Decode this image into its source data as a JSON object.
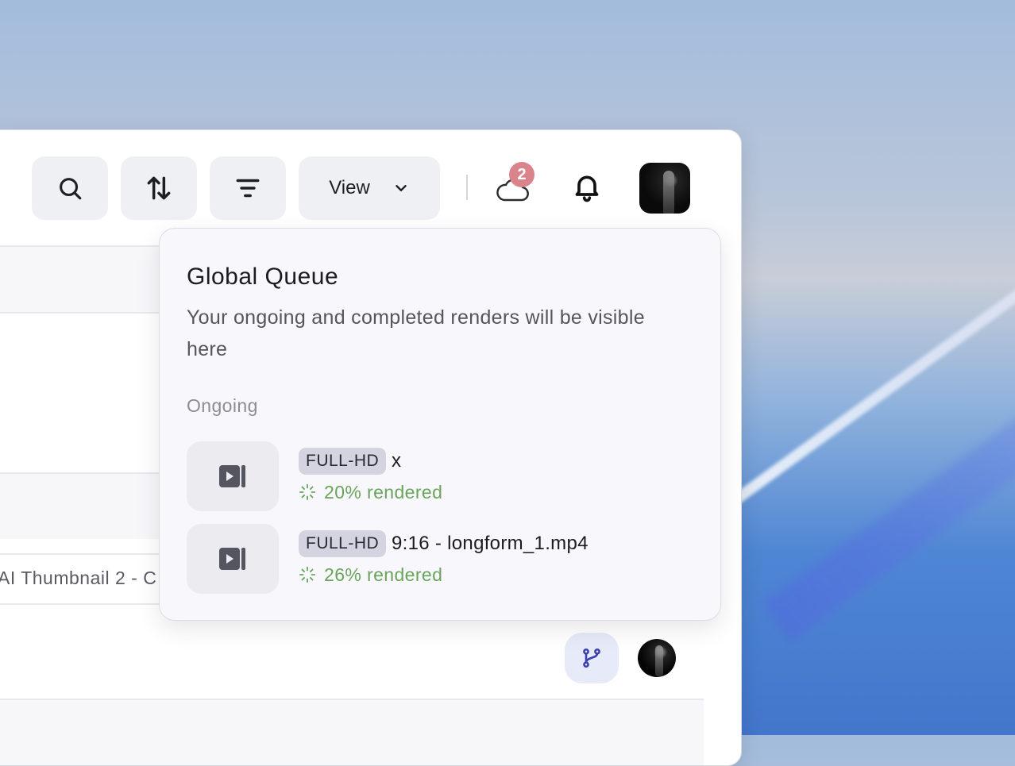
{
  "toolbar": {
    "view_label": "View",
    "notification_badge_count": "2"
  },
  "background_row": {
    "thumbnail_text": "AI Thumbnail 2 - C"
  },
  "global_queue": {
    "title": "Global Queue",
    "subtitle": "Your ongoing and completed renders will be visible here",
    "section_ongoing": "Ongoing",
    "jobs": [
      {
        "quality": "FULL-HD",
        "name": "x",
        "status": "20% rendered",
        "progress_percent": 20
      },
      {
        "quality": "FULL-HD",
        "name": "9:16 - longform_1.mp4",
        "status": "26% rendered",
        "progress_percent": 26
      }
    ]
  },
  "colors": {
    "status_green": "#6aa35c",
    "badge_red": "#d9838a",
    "tag_bg": "#d3d4e0"
  }
}
